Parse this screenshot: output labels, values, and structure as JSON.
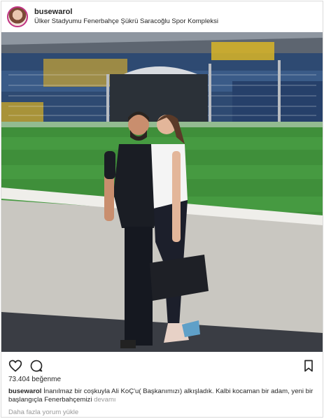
{
  "header": {
    "username": "busewarol",
    "location": "Ülker Stadyumu Fenerbahçe Şükrü Saracoğlu Spor Kompleksi"
  },
  "actions": {
    "like_icon": "heart-icon",
    "comment_icon": "comment-icon",
    "save_icon": "bookmark-icon"
  },
  "likes": "73.404 beğenme",
  "caption": {
    "username": "busewarol",
    "text": "İnanılmaz bir coşkuyla Ali KoÇ'u( Başkanımızı) alkışladık. Kalbi kocaman bir adam, yeni bir başlangıçla Fenerbahçemizi",
    "more": "devamı"
  },
  "load_comments": "Daha fazla yorum yükle",
  "colors": {
    "pitch": "#3f8f3a",
    "seats": "#2f4f7a",
    "seats_yellow": "#d9b526",
    "wall": "#c9c7c1",
    "text": "#262626",
    "muted": "#999999"
  }
}
